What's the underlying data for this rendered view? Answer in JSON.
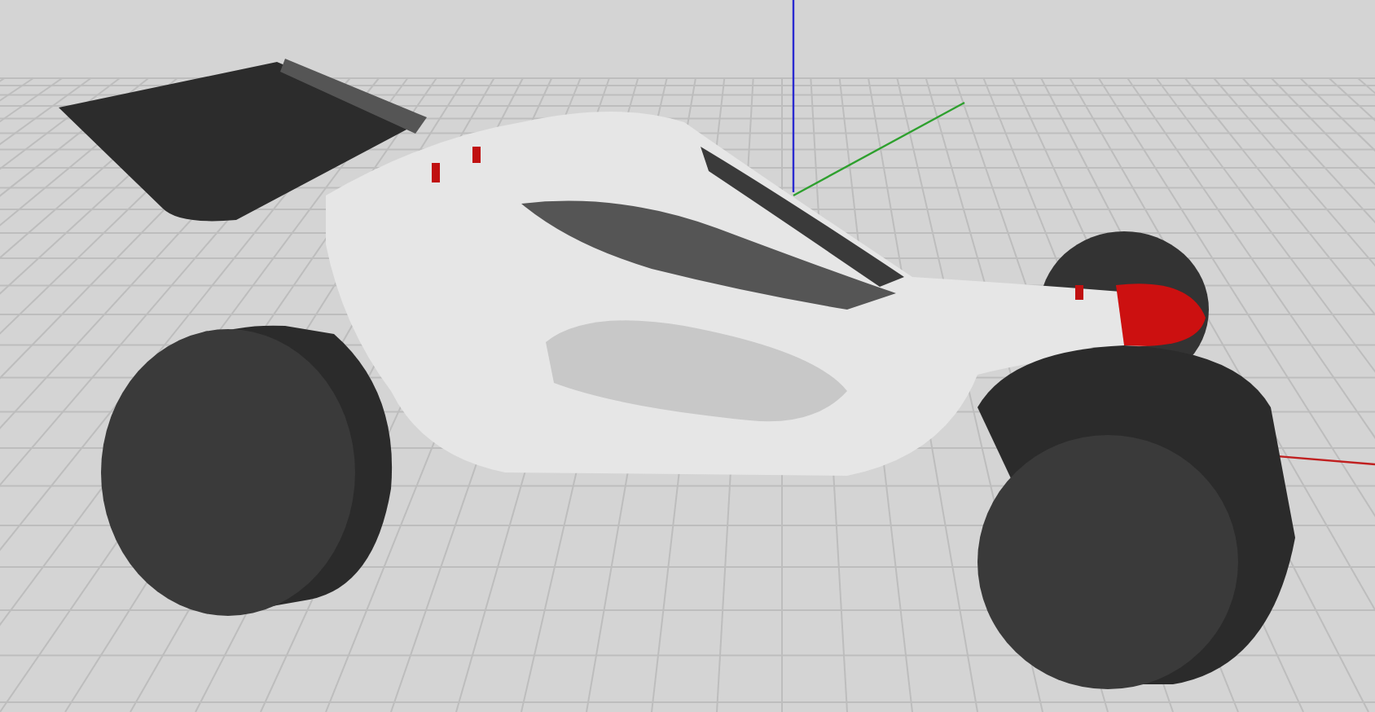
{
  "scene": {
    "kind": "viewport"
  }
}
